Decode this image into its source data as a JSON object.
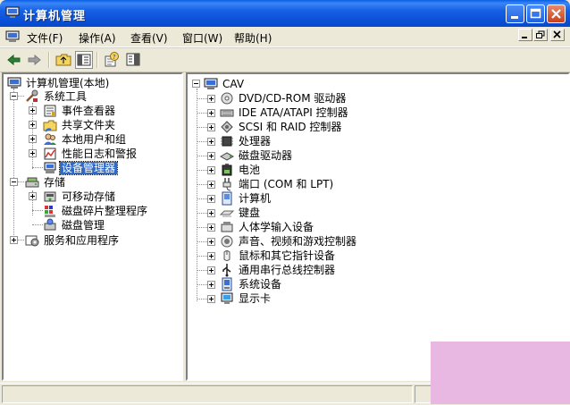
{
  "window": {
    "title": "计算机管理"
  },
  "menu": [
    {
      "id": "file",
      "label": "文件(F)"
    },
    {
      "id": "action",
      "label": "操作(A)"
    },
    {
      "id": "view",
      "label": "查看(V)"
    },
    {
      "id": "window",
      "label": "窗口(W)"
    },
    {
      "id": "help",
      "label": "帮助(H)"
    }
  ],
  "left_tree": {
    "root": "计算机管理(本地)",
    "system_tools": "系统工具",
    "event_viewer": "事件查看器",
    "shared_folders": "共享文件夹",
    "local_users": "本地用户和组",
    "perf_logs": "性能日志和警报",
    "device_manager": "设备管理器",
    "storage": "存储",
    "removable": "可移动存储",
    "defrag": "磁盘碎片整理程序",
    "disk_mgmt": "磁盘管理",
    "services": "服务和应用程序"
  },
  "right_tree": {
    "root": "CAV",
    "devices": [
      {
        "label": "DVD/CD-ROM 驱动器",
        "icon": "cdrom-icon"
      },
      {
        "label": "IDE ATA/ATAPI 控制器",
        "icon": "ide-controller-icon"
      },
      {
        "label": "SCSI 和 RAID 控制器",
        "icon": "scsi-controller-icon"
      },
      {
        "label": "处理器",
        "icon": "processor-icon"
      },
      {
        "label": "磁盘驱动器",
        "icon": "disk-drive-icon"
      },
      {
        "label": "电池",
        "icon": "battery-icon"
      },
      {
        "label": "端口 (COM 和 LPT)",
        "icon": "port-icon"
      },
      {
        "label": "计算机",
        "icon": "computer-icon"
      },
      {
        "label": "键盘",
        "icon": "keyboard-icon"
      },
      {
        "label": "人体学输入设备",
        "icon": "hid-icon"
      },
      {
        "label": "声音、视频和游戏控制器",
        "icon": "sound-icon"
      },
      {
        "label": "鼠标和其它指针设备",
        "icon": "mouse-icon"
      },
      {
        "label": "通用串行总线控制器",
        "icon": "usb-icon"
      },
      {
        "label": "系统设备",
        "icon": "system-device-icon"
      },
      {
        "label": "显示卡",
        "icon": "display-adapter-icon"
      }
    ]
  },
  "colors": {
    "title_blue": "#0a4fd6",
    "selection": "#316ac5",
    "close_red": "#c8401c"
  }
}
